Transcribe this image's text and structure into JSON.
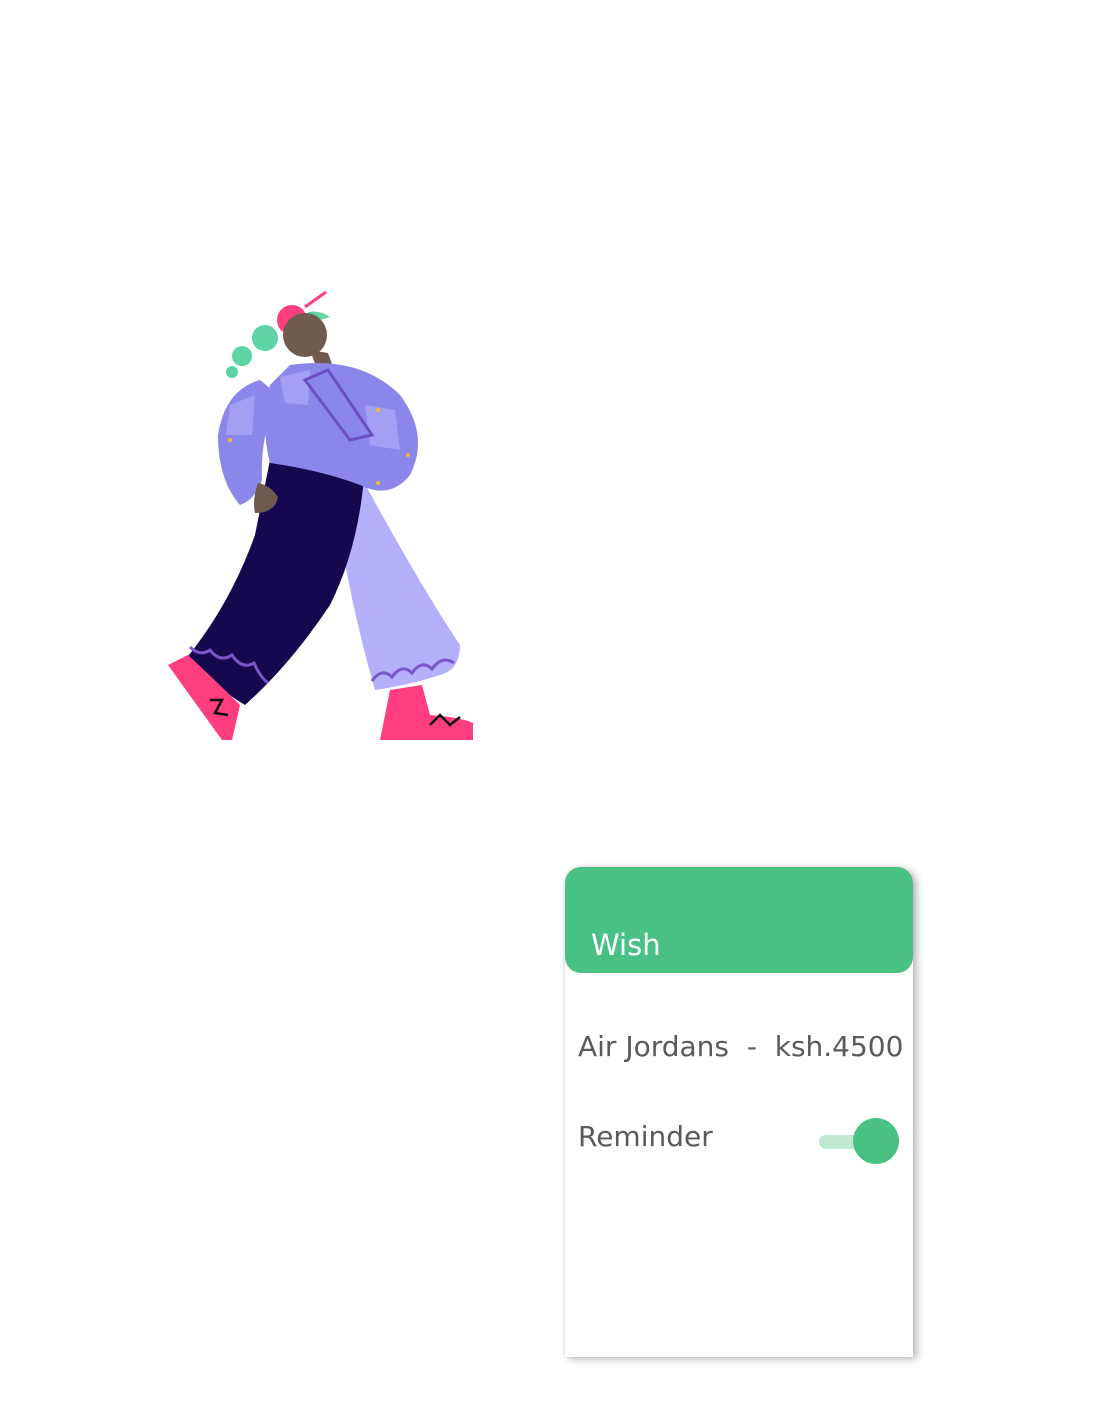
{
  "card": {
    "title": "Wish",
    "item": "Air Jordans  -  ksh.4500",
    "reminder_label": "Reminder",
    "reminder_on": true
  },
  "colors": {
    "accent": "#49c185",
    "text": "#5a5a5a",
    "background": "#ffffff"
  }
}
